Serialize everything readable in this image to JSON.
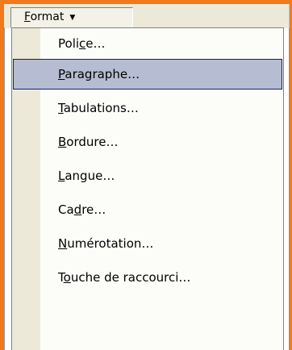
{
  "menubar": {
    "format_menu": {
      "mnemonic": "F",
      "rest": "ormat"
    }
  },
  "dropdown": {
    "items": [
      {
        "pre": "Poli",
        "mn": "c",
        "post": "e…",
        "highlighted": false
      },
      {
        "pre": "",
        "mn": "P",
        "post": "aragraphe…",
        "highlighted": true
      },
      {
        "pre": "",
        "mn": "T",
        "post": "abulations…",
        "highlighted": false
      },
      {
        "pre": "",
        "mn": "B",
        "post": "ordure…",
        "highlighted": false
      },
      {
        "pre": "",
        "mn": "L",
        "post": "angue…",
        "highlighted": false
      },
      {
        "pre": "Ca",
        "mn": "d",
        "post": "re…",
        "highlighted": false
      },
      {
        "pre": "",
        "mn": "N",
        "post": "umérotation…",
        "highlighted": false
      },
      {
        "pre": "T",
        "mn": "o",
        "post": "uche de raccourci…",
        "highlighted": false
      }
    ]
  },
  "colors": {
    "frame_border": "#f07a1c",
    "highlight_fill": "#b6bdd2",
    "highlight_border": "#0a246a"
  }
}
